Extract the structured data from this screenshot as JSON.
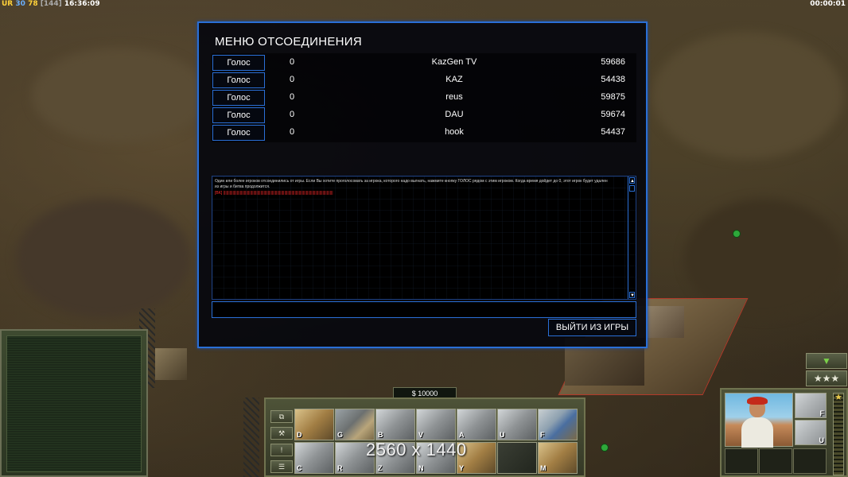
{
  "hud": {
    "tag": "UR",
    "fps": "30",
    "ping": "78",
    "bracket": "[144]",
    "clock": "16:36:09",
    "timer": "00:00:01"
  },
  "dialog": {
    "title": "МЕНЮ ОТСОЕДИНЕНИЯ",
    "vote_label": "Голос",
    "players": [
      {
        "votes": "0",
        "name": "KazGen TV",
        "id": "59686"
      },
      {
        "votes": "0",
        "name": "KAZ",
        "id": "54438"
      },
      {
        "votes": "0",
        "name": "reus",
        "id": "59875"
      },
      {
        "votes": "0",
        "name": "DAU",
        "id": "59674"
      },
      {
        "votes": "0",
        "name": "hook",
        "id": "54437"
      }
    ],
    "message": "Один или более игроков отсоединились от игры. Если Вы хотите проголосовать за игрока, которого надо выгнать, нажмите кнопку ГОЛОС рядом с этим игроком. Когда время дойдет до 0, этот игрок будет удален из игры и битва продолжится.",
    "message_red": "[BK] ||||||||||||||||||||||||||||||||||||||||||||||||||||||||||||||||||||||||||||||||||||||||||||||||||||||||||",
    "quit_label": "ВЫЙТИ ИЗ ИГРЫ"
  },
  "money": "$ 10000",
  "build_hotkeys": [
    "D",
    "G",
    "B",
    "V",
    "A",
    "U",
    "F",
    "C",
    "R",
    "Z",
    "N",
    "Y",
    "",
    "M"
  ],
  "weapon_hotkeys": [
    "F",
    "U"
  ],
  "watermark": "2560 x 1440",
  "rank_stars": "★★★",
  "rank_arrow": "▼"
}
